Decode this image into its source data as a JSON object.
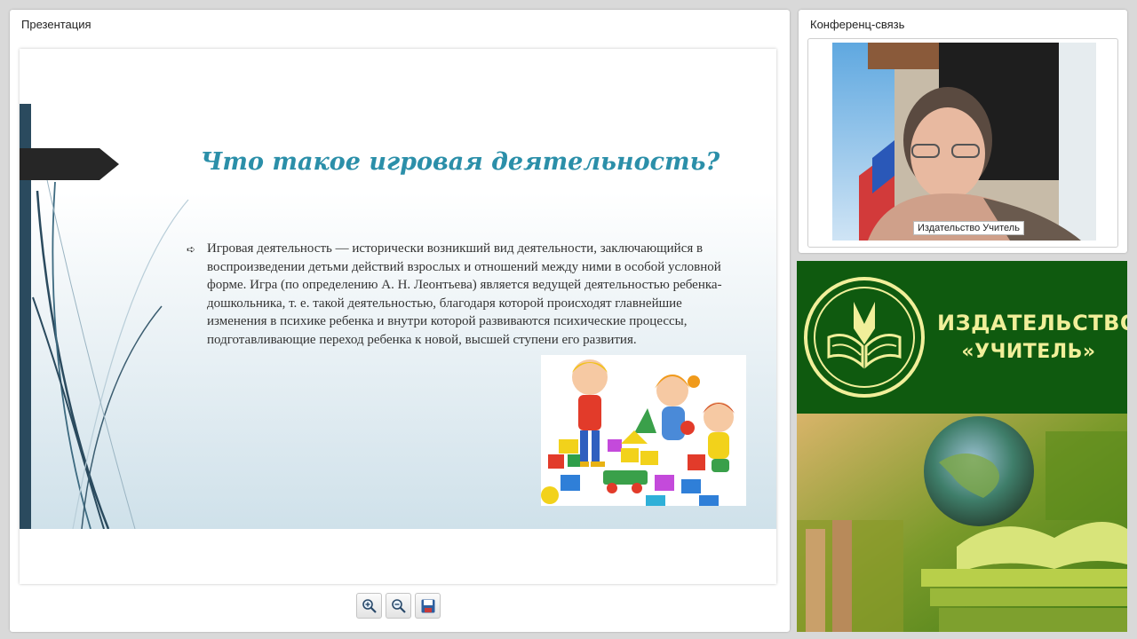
{
  "presentation": {
    "pod_title": "Презентация",
    "slide": {
      "title": "Что такое игровая деятельность?",
      "bullet_text": "Игровая деятельность — исторически возникший вид деятельности, заключающийся в воспроизведении детьми действий взрослых и отношений между ними в особой условной форме. Игра (по определению А. Н. Леонтьева) является ведущей деятельностью ребенка-дошкольника, т. е. такой деятельностью, благодаря которой происходят главнейшие изменения в психике ребенка и внутри которой развиваются психические процессы, подготавливающие переход ребенка к новой, высшей ступени его развития.",
      "image": "children-playing-with-blocks-illustration"
    },
    "toolbar": {
      "zoom_in_icon": "zoom-in-icon",
      "zoom_out_icon": "zoom-out-icon",
      "save_icon": "save-icon"
    }
  },
  "video": {
    "pod_title": "Конференц-связь",
    "participant_name": "Издательство Учитель"
  },
  "banner": {
    "name_line1": "ИЗДАТЕЛЬСТВО",
    "name_line2": "«УЧИТЕЛЬ»"
  },
  "colors": {
    "slide_title": "#2b8fa9",
    "banner_green": "#0f5a0f",
    "banner_text": "#f1ef9a"
  }
}
